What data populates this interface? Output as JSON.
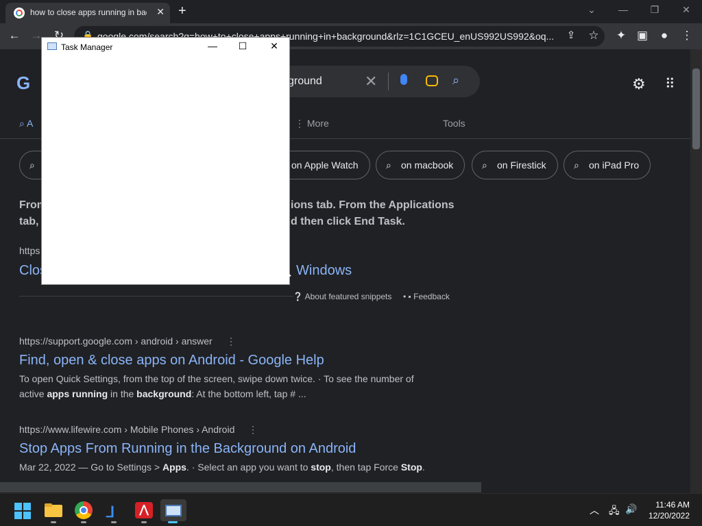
{
  "browser": {
    "tab_title": "how to close apps running in background",
    "tab_close": "✕",
    "new_tab": "+",
    "url": "google.com/search?q=how+to+close+apps+running+in+background&rlz=1C1GCEU_enUS992US992&oq...",
    "window_controls": {
      "dropdown": "⌄",
      "minimize": "—",
      "restore": "❐",
      "close": "✕"
    },
    "nav_icons": {
      "back": "←",
      "forward": "→",
      "reload": "↻"
    },
    "toolbar_icons": {
      "share": "⇪",
      "star": "☆",
      "extensions": "✦",
      "sidepanel": "▣",
      "profile": "●",
      "menu": "⋮"
    }
  },
  "search": {
    "query_visible": "ground",
    "clear": "✕",
    "settings_icon": "⚙",
    "apps_icon": "⋮⋮⋮",
    "logo_fragment": "G",
    "tabs": {
      "all": "A",
      "more": "More",
      "tools": "Tools"
    },
    "chips": [
      {
        "label": "on Apple Watch"
      },
      {
        "label": "on macbook"
      },
      {
        "label": "on Firestick"
      },
      {
        "label": "on iPad Pro"
      }
    ],
    "snippet_line1_left": "From",
    "snippet_line1_right": "ions tab. From the Applications",
    "snippet_line2_left": "tab,",
    "snippet_line2_right": "d then click End Task.",
    "snippet_cite_left": "https",
    "snippet_title_left": "Clos",
    "snippet_title_right": "Windows",
    "about_snippets": "About featured snippets",
    "feedback": "Feedback",
    "results": [
      {
        "cite": "https://support.google.com › android › answer",
        "title": "Find, open & close apps on Android - Google Help",
        "desc_html_line1": "To open Quick Settings, from the top of the screen, swipe down twice. · To see the number of",
        "desc_line2_a": "active ",
        "desc_line2_b": "apps running",
        "desc_line2_c": " in the ",
        "desc_line2_d": "background",
        "desc_line2_e": ": At the bottom left, tap # ..."
      },
      {
        "cite": "https://www.lifewire.com › Mobile Phones › Android",
        "title": "Stop Apps From Running in the Background on Android",
        "desc_a": "Mar 22, 2022 — Go to Settings > ",
        "desc_b": "Apps",
        "desc_c": ". · Select an app you want to ",
        "desc_d": "stop",
        "desc_e": ", then tap Force ",
        "desc_f": "Stop",
        "desc_g": "."
      }
    ]
  },
  "task_manager": {
    "title": "Task Manager",
    "minimize": "—",
    "maximize": "☐",
    "close": "✕"
  },
  "taskbar": {
    "time": "11:46 AM",
    "date": "12/20/2022",
    "tray_chevron": "︿",
    "tray_network": "🖧",
    "tray_volume": "🔊"
  }
}
